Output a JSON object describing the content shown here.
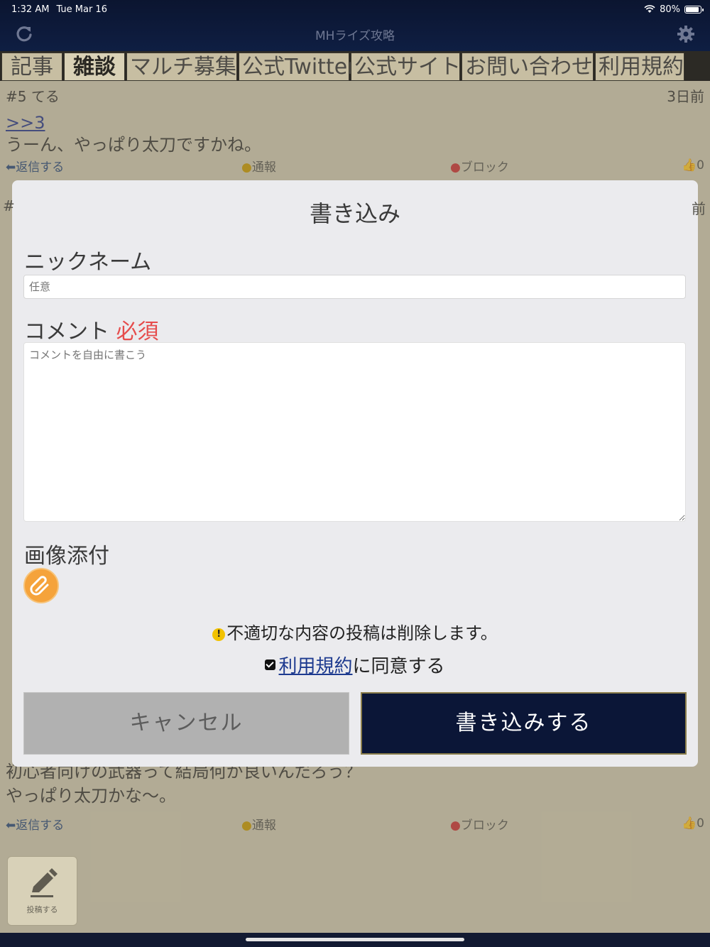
{
  "status_bar": {
    "time": "1:32 AM",
    "date": "Tue Mar 16",
    "battery": "80%",
    "battery_level": 0.8
  },
  "nav": {
    "title": "MHライズ攻略",
    "refresh_icon": "refresh-icon",
    "settings_icon": "gear-icon"
  },
  "tabs": [
    {
      "label": "記事",
      "active": false
    },
    {
      "label": "雑談",
      "active": true
    },
    {
      "label": "マルチ募集",
      "active": false
    },
    {
      "label": "公式Twitter",
      "active": false
    },
    {
      "label": "公式サイト",
      "active": false
    },
    {
      "label": "お問い合わせ",
      "active": false
    },
    {
      "label": "利用規約",
      "active": false
    }
  ],
  "posts": {
    "top": {
      "number": "#5",
      "name": "てる",
      "time": "3日前",
      "reply_to": ">>3",
      "body": "うーん、やっぱり太刀ですかね。",
      "actions": {
        "reply": "返信する",
        "report": "通報",
        "block": "ブロック",
        "likes": "0"
      }
    },
    "bottom": {
      "body_line1": "初心者向けの武器って結局何が良いんだろう？",
      "body_line2": "やっぱり太刀かな～。",
      "actions": {
        "reply": "返信する",
        "report": "通報",
        "block": "ブロック",
        "likes": "0"
      }
    }
  },
  "post_button": {
    "label": "投稿する",
    "icon": "pencil-icon"
  },
  "modal": {
    "title": "書き込み",
    "nickname_label": "ニックネーム",
    "nickname_placeholder": "任意",
    "comment_label": "コメント",
    "required_label": "必須",
    "comment_placeholder": "コメントを自由に書こう",
    "attach_label": "画像添付",
    "attach_icon": "paperclip-icon",
    "warning": "不適切な内容の投稿は削除します。",
    "agree_link": "利用規約",
    "agree_suffix": "に同意する",
    "agree_checked": true,
    "cancel_label": "キャンセル",
    "submit_label": "書き込みする"
  }
}
